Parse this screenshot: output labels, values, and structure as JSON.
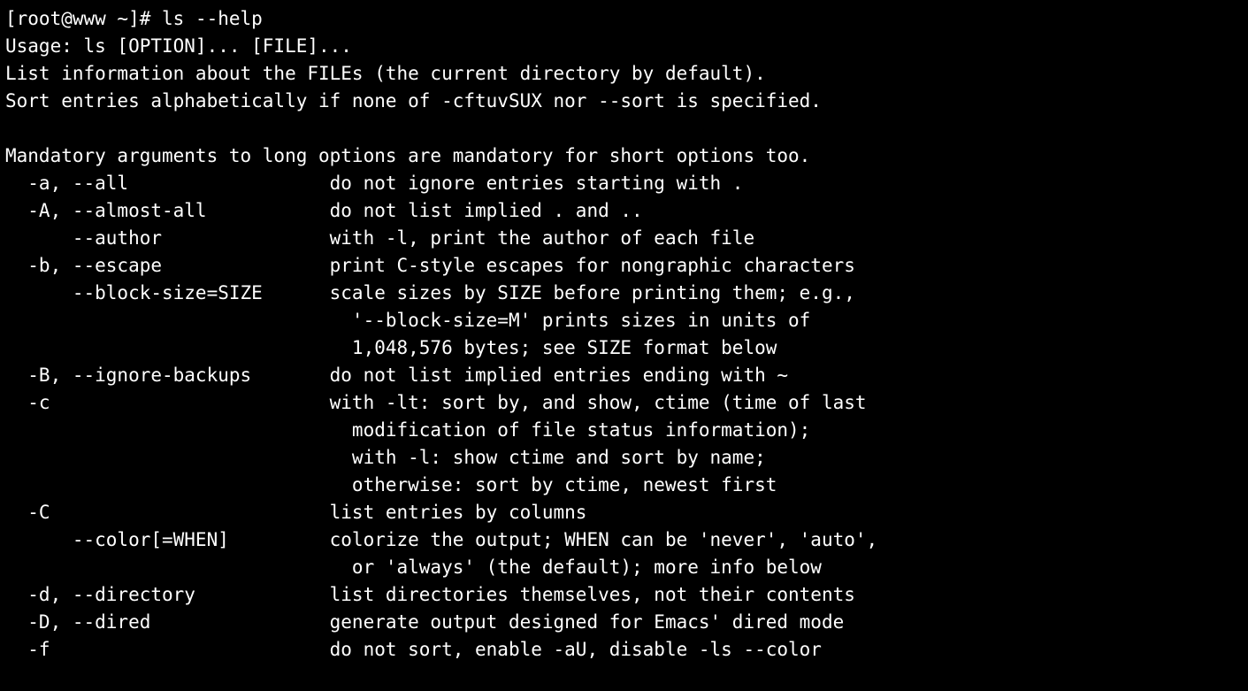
{
  "terminal": {
    "prompt": "[root@www ~]# ",
    "command": "ls --help",
    "output_lines": [
      "Usage: ls [OPTION]... [FILE]...",
      "List information about the FILEs (the current directory by default).",
      "Sort entries alphabetically if none of -cftuvSUX nor --sort is specified.",
      "",
      "Mandatory arguments to long options are mandatory for short options too.",
      "  -a, --all                  do not ignore entries starting with .",
      "  -A, --almost-all           do not list implied . and ..",
      "      --author               with -l, print the author of each file",
      "  -b, --escape               print C-style escapes for nongraphic characters",
      "      --block-size=SIZE      scale sizes by SIZE before printing them; e.g.,",
      "                               '--block-size=M' prints sizes in units of",
      "                               1,048,576 bytes; see SIZE format below",
      "  -B, --ignore-backups       do not list implied entries ending with ~",
      "  -c                         with -lt: sort by, and show, ctime (time of last",
      "                               modification of file status information);",
      "                               with -l: show ctime and sort by name;",
      "                               otherwise: sort by ctime, newest first",
      "  -C                         list entries by columns",
      "      --color[=WHEN]         colorize the output; WHEN can be 'never', 'auto',",
      "                               or 'always' (the default); more info below",
      "  -d, --directory            list directories themselves, not their contents",
      "  -D, --dired                generate output designed for Emacs' dired mode",
      "  -f                         do not sort, enable -aU, disable -ls --color"
    ]
  },
  "colors": {
    "background": "#000000",
    "foreground": "#ffffff"
  }
}
